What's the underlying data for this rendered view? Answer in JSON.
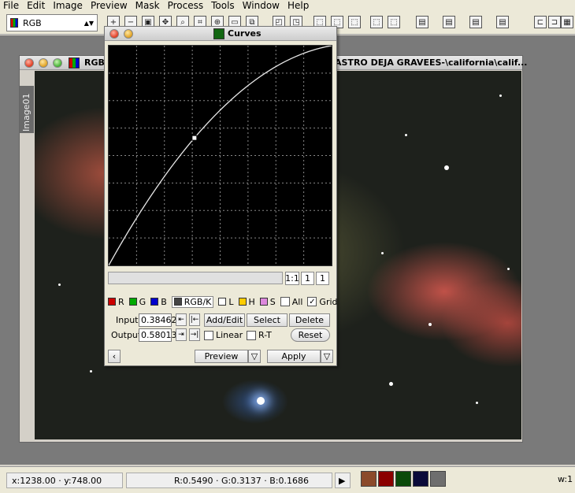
{
  "menubar": {
    "items": [
      "File",
      "Edit",
      "Image",
      "Preview",
      "Mask",
      "Process",
      "Tools",
      "Window",
      "Help"
    ]
  },
  "toolbar": {
    "color_mode": "RGB"
  },
  "image_window": {
    "title_left": "RGB",
    "title_right": "ASTRO DEJA GRAVEES-\\california\\calif...",
    "side_tab": "Image01"
  },
  "curves": {
    "title": "Curves",
    "zoom_ratio": "1:1",
    "zoom_a": "1",
    "zoom_b": "1",
    "channels": [
      {
        "label": "R",
        "color": "#cc0000"
      },
      {
        "label": "G",
        "color": "#00aa00"
      },
      {
        "label": "B",
        "color": "#0000cc"
      },
      {
        "label": "RGB/K",
        "color": "#444444"
      },
      {
        "label": "L",
        "color": "#ffffff"
      },
      {
        "label": "H",
        "color": "#ffcc00"
      },
      {
        "label": "S",
        "color": "#dd88dd"
      }
    ],
    "active_channel": "RGB/K",
    "all_label": "All",
    "all_checked": false,
    "grid_label": "Grid",
    "grid_checked": true,
    "input_label": "Input:",
    "input_value": "0.38462",
    "output_label": "Output:",
    "output_value": "0.58013",
    "add_edit_label": "Add/Edit",
    "select_label": "Select",
    "delete_label": "Delete",
    "linear_label": "Linear",
    "rt_label": "R-T",
    "reset_label": "Reset",
    "preview_label": "Preview",
    "apply_label": "Apply",
    "curve_points": [
      [
        0,
        0
      ],
      [
        0.38462,
        0.58013
      ],
      [
        1,
        1
      ]
    ]
  },
  "statusbar": {
    "coords": "x:1238.00 · y:748.00",
    "rgb": "R:0.5490 · G:0.3137 · B:0.1686",
    "right_text": "w:1",
    "swatches": [
      "#8b4a2b",
      "#8b0000",
      "#0a4a0a",
      "#0a0a3a",
      "#6e6e6e"
    ]
  }
}
